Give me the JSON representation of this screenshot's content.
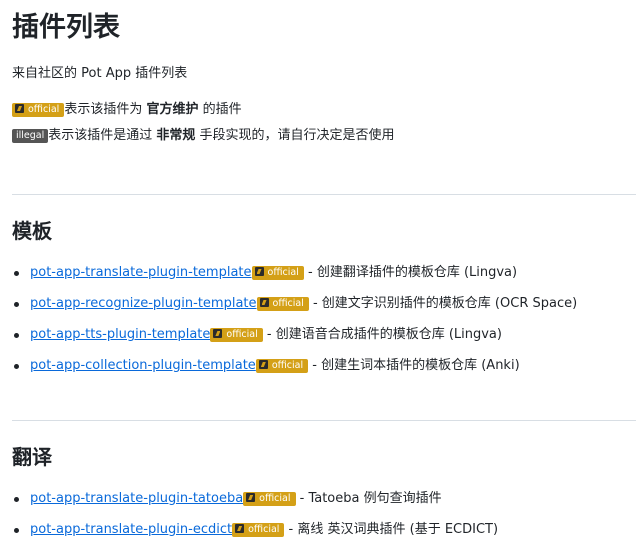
{
  "title": "插件列表",
  "subtitle": "来自社区的 Pot App 插件列表",
  "legend": {
    "official_badge": "official",
    "official_pre": "表示该插件为 ",
    "official_bold": "官方维护",
    "official_post": " 的插件",
    "illegal_badge": "illegal",
    "illegal_pre": "表示该插件是通过 ",
    "illegal_bold": "非常规",
    "illegal_post": " 手段实现的，请自行决定是否使用"
  },
  "sections": [
    {
      "heading": "模板",
      "items": [
        {
          "link": "pot-app-translate-plugin-template",
          "badge": "official",
          "desc": " - 创建翻译插件的模板仓库 (Lingva)"
        },
        {
          "link": "pot-app-recognize-plugin-template",
          "badge": "official",
          "desc": " - 创建文字识别插件的模板仓库 (OCR Space)"
        },
        {
          "link": "pot-app-tts-plugin-template",
          "badge": "official",
          "desc": " - 创建语音合成插件的模板仓库 (Lingva)"
        },
        {
          "link": "pot-app-collection-plugin-template",
          "badge": "official",
          "desc": " - 创建生词本插件的模板仓库 (Anki)"
        }
      ]
    },
    {
      "heading": "翻译",
      "items": [
        {
          "link": "pot-app-translate-plugin-tatoeba",
          "badge": "official",
          "desc": " - Tatoeba 例句查询插件"
        },
        {
          "link": "pot-app-translate-plugin-ecdict",
          "badge": "official",
          "desc": " - 离线 英汉词典插件 (基于 ECDICT)"
        }
      ]
    }
  ]
}
